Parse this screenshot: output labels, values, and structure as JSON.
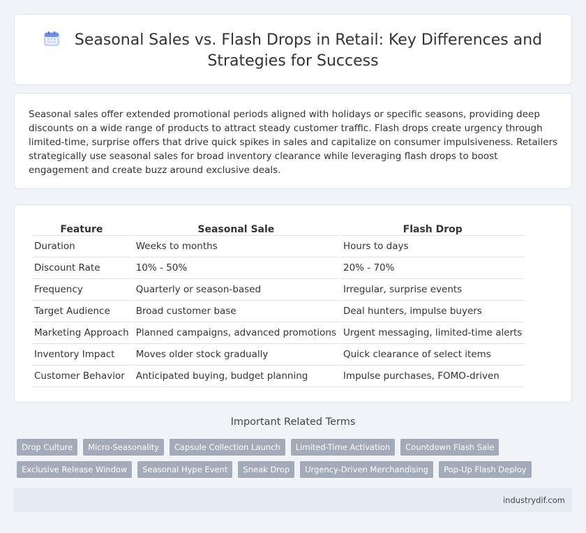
{
  "header": {
    "title_line1": "Seasonal Sales vs. Flash Drops in Retail: Key Differences and",
    "title_line2": "Strategies for Success",
    "icon": "calendar-icon"
  },
  "intro": {
    "text": "Seasonal sales offer extended promotional periods aligned with holidays or specific seasons, providing deep discounts on a wide range of products to attract steady customer traffic. Flash drops create urgency through limited-time, surprise offers that drive quick spikes in sales and capitalize on consumer impulsiveness. Retailers strategically use seasonal sales for broad inventory clearance while leveraging flash drops to boost engagement and create buzz around exclusive deals."
  },
  "table": {
    "headers": [
      "Feature",
      "Seasonal Sale",
      "Flash Drop"
    ],
    "rows": [
      [
        "Duration",
        "Weeks to months",
        "Hours to days"
      ],
      [
        "Discount Rate",
        "10% - 50%",
        "20% - 70%"
      ],
      [
        "Frequency",
        "Quarterly or season-based",
        "Irregular, surprise events"
      ],
      [
        "Target Audience",
        "Broad customer base",
        "Deal hunters, impulse buyers"
      ],
      [
        "Marketing Approach",
        "Planned campaigns, advanced promotions",
        "Urgent messaging, limited-time alerts"
      ],
      [
        "Inventory Impact",
        "Moves older stock gradually",
        "Quick clearance of select items"
      ],
      [
        "Customer Behavior",
        "Anticipated buying, budget planning",
        "Impulse purchases, FOMO-driven"
      ]
    ]
  },
  "related": {
    "heading": "Important Related Terms",
    "row1": [
      "Drop Culture",
      "Micro-Seasonality",
      "Capsule Collection Launch",
      "Limited-Time Activation",
      "Countdown Flash Sale"
    ],
    "row2": [
      "Exclusive Release Window",
      "Seasonal Hype Event",
      "Sneak Drop",
      "Urgency-Driven Merchandising",
      "Pop-Up Flash Deploy"
    ]
  },
  "footer": {
    "site": "industrydif.com"
  },
  "colors": {
    "background": "#f0f3f8",
    "tag": "#a3abb8",
    "footer": "#e6ebf3",
    "icon_blue": "#5b8def"
  }
}
